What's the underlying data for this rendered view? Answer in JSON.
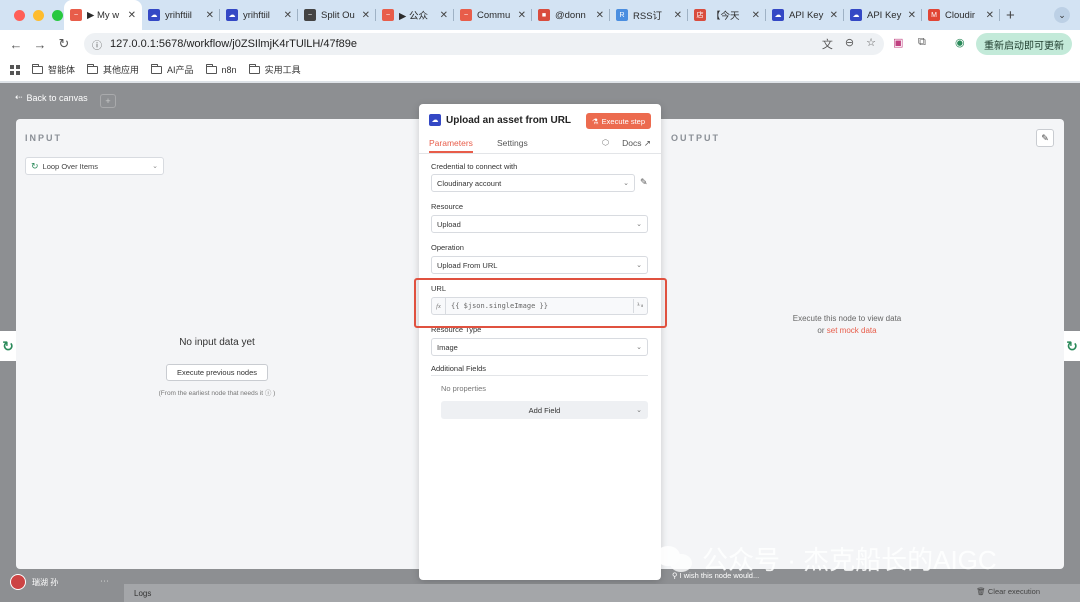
{
  "browser": {
    "tabs": [
      {
        "title": "▶ My w",
        "fav_color": "#e85d4a",
        "fav_glyph": "~",
        "active": true
      },
      {
        "title": "yrihftiil",
        "fav_color": "#3448c5",
        "fav_glyph": "☁"
      },
      {
        "title": "yrihftiil",
        "fav_color": "#3448c5",
        "fav_glyph": "☁"
      },
      {
        "title": "Split Ou",
        "fav_color": "#444444",
        "fav_glyph": "~"
      },
      {
        "title": "▶ 公众",
        "fav_color": "#e85d4a",
        "fav_glyph": "~"
      },
      {
        "title": "Commu",
        "fav_color": "#e85d4a",
        "fav_glyph": "~"
      },
      {
        "title": "@donn",
        "fav_color": "#d94c3d",
        "fav_glyph": "■"
      },
      {
        "title": "RSS订",
        "fav_color": "#4a8ee0",
        "fav_glyph": "R"
      },
      {
        "title": "【今天",
        "fav_color": "#d94c3d",
        "fav_glyph": "店"
      },
      {
        "title": "API Key",
        "fav_color": "#3448c5",
        "fav_glyph": "☁"
      },
      {
        "title": "API Key",
        "fav_color": "#3448c5",
        "fav_glyph": "☁"
      },
      {
        "title": "Cloudir",
        "fav_color": "#e14535",
        "fav_glyph": "M"
      }
    ],
    "new_tab": "+",
    "url": "127.0.0.1:5678/workflow/j0ZSIlmjK4rTUlLH/47f89e",
    "restart_label": "重新启动即可更新",
    "bookmarks": [
      "智能体",
      "其他应用",
      "AI产品",
      "n8n",
      "实用工具"
    ]
  },
  "app": {
    "back_label": "Back to canvas",
    "input_title": "INPUT",
    "output_title": "OUTPUT",
    "loop_select": "Loop Over Items",
    "no_input": "No input data yet",
    "execute_previous": "Execute previous nodes",
    "earliest_note": "(From the earliest node that needs it ⓘ )",
    "output_msg": "Execute this node to view data",
    "output_or": "or",
    "mock_link": "set mock data",
    "wish": "I wish this node would...",
    "logs": "Logs",
    "clear_execution": "Clear execution",
    "user_name": "瑞湖 孙"
  },
  "node": {
    "title": "Upload an asset from URL",
    "execute_step": "Execute step",
    "tab_parameters": "Parameters",
    "tab_settings": "Settings",
    "docs": "Docs",
    "credential_label": "Credential to connect with",
    "credential_value": "Cloudinary account",
    "resource_label": "Resource",
    "resource_value": "Upload",
    "operation_label": "Operation",
    "operation_value": "Upload From URL",
    "url_label": "URL",
    "url_fx": "fx",
    "url_value": "{{ $json.singleImage }}",
    "url_mode": "⅟₀",
    "resource_type_label": "Resource Type",
    "resource_type_value": "Image",
    "additional_fields_label": "Additional Fields",
    "no_properties": "No properties",
    "add_field": "Add Field"
  },
  "watermark": "公众号 · 杰克船长的AIGC",
  "colors": {
    "accent": "#e85d4a",
    "highlight": "#e0513f",
    "restart_bg": "#c3ead9"
  }
}
